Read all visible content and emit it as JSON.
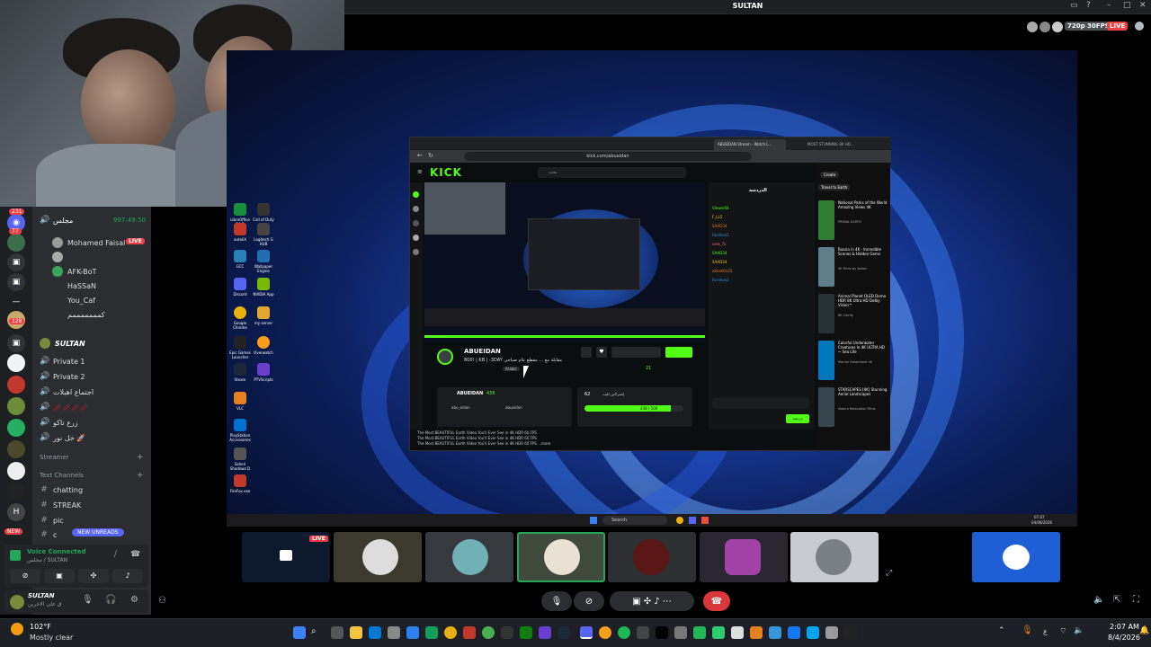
{
  "window": {
    "title": "SULTAN",
    "quality_badge": "720p 30FPS",
    "live_badge": "LIVE"
  },
  "servers": {
    "badges": [
      "231",
      "77",
      "128"
    ],
    "new_label": "NEW"
  },
  "channels": {
    "current_voice": {
      "name": "مجلس",
      "time": "997:49:50"
    },
    "members": [
      {
        "name": "Mohamed Faisal",
        "live": "LIVE"
      },
      {
        "name": "AFK-BoT"
      },
      {
        "name": "HaSSaN"
      },
      {
        "name": "You_Caf"
      },
      {
        "name": "كمممممممم"
      }
    ],
    "sultan_label": "SULTAN",
    "voice_channels": [
      "Private 1",
      "Private 2",
      "اجتماع اهبلات",
      "🥢🥢🥢🥢",
      "زرع تاكو",
      "خل نور 🚀"
    ],
    "streamer_label": "Streamer",
    "text_channels_label": "Text Channels",
    "text_channels": [
      "chatting",
      "STREAK",
      "pic",
      "c"
    ],
    "new_unreads": "NEW UNREADS"
  },
  "voice_panel": {
    "status": "Voice Connected",
    "channel": "مجلس / SULTAN"
  },
  "user_panel": {
    "name": "SULTAN",
    "status": "ق على الاخرين"
  },
  "desktop_icons": [
    "LibreOffice 24.2",
    "Call of Duty",
    "autoliX",
    "Logitech G HUB",
    "GCC",
    "Wallpaper Engine",
    "Discord",
    "NVIDIA App",
    "Google Chrome",
    "my server",
    "Epic Games Launcher",
    "Overwatch",
    "Steam",
    "PTVScripts",
    "VLC",
    "PlayStation Accessories",
    "Saheri Shadowz D",
    "FireFox.exe"
  ],
  "browser": {
    "tab_title": "ABUEIDAN Stream - Watch L...",
    "tab2_title": "MOST STUNNING 8K HD...",
    "url": "kick.com/abueidan",
    "logo": "KICK",
    "search_placeholder": "بحث",
    "streamer_name": "ABUEIDAN",
    "stream_title": "800! | KB | -3DAY مقابلة مع ... مقطع عام صباحي",
    "category": "Arabic",
    "viewers": "21",
    "about_name": "ABUEIDAN",
    "followers": "436",
    "social_1": "abu_eidan",
    "social_2": "abueidan",
    "goal_label": "إشتراكين للبث",
    "goal_value": "62",
    "goal_progress_text": "438 / 500",
    "chat_header": "الدردشة",
    "chat_users": [
      "Viewer64",
      "F_LL5",
      "SAAD34",
      "Fariskox2",
      "sara_7z",
      "SAAD34",
      "SAAD34",
      "abood0x25",
      "Fariskox2"
    ],
    "chat_send": "دردشة",
    "video_lines": [
      "The Most BEAUTIFUL Earth Video You'll Ever See in 4K HDR 60 FPS",
      "The Most BEAUTIFUL Earth Video You'll Ever See in 4K HDR 60 FPS",
      "The Most BEAUTIFUL Earth Video You'll Ever See in 4K HDR 60 FPS ...more"
    ],
    "yt_items": [
      {
        "title": "National Parks of the World Amazing Views 4K",
        "channel": "PRIMAL EARTH"
      },
      {
        "title": "Russia in 4K - Incredible Scenes & Hidden Gems",
        "channel": "4K Films by Adrian"
      },
      {
        "title": "Animal Planet OLED Demo HDR 8K Ultra HD Dolby Vision™",
        "channel": "8K Clarity"
      },
      {
        "title": "Colorful Underwater Creatures In 4K ULTRA HD ~ Sea Life",
        "channel": "Marine Dreamland 4K"
      },
      {
        "title": "STARSCAPES [4K] Stunning Aerial Landscapes",
        "channel": "Nature Relaxation Films"
      }
    ],
    "yt_create": "Create",
    "yt_chip": "Travel to Earth"
  },
  "stage_taskbar": {
    "search": "Search",
    "time": "07:07",
    "date": "04/08/2026"
  },
  "tiles": {
    "live_label": "LIVE"
  },
  "weather": {
    "temp": "102°F",
    "desc": "Mostly clear"
  },
  "clock": {
    "time": "2:07 AM",
    "date": "8/4/2026",
    "lang": "ع"
  },
  "colors": {
    "live": "#ed4245",
    "kick_green": "#53fc18",
    "discord_blurple": "#5865f2",
    "hangup": "#da373c"
  }
}
